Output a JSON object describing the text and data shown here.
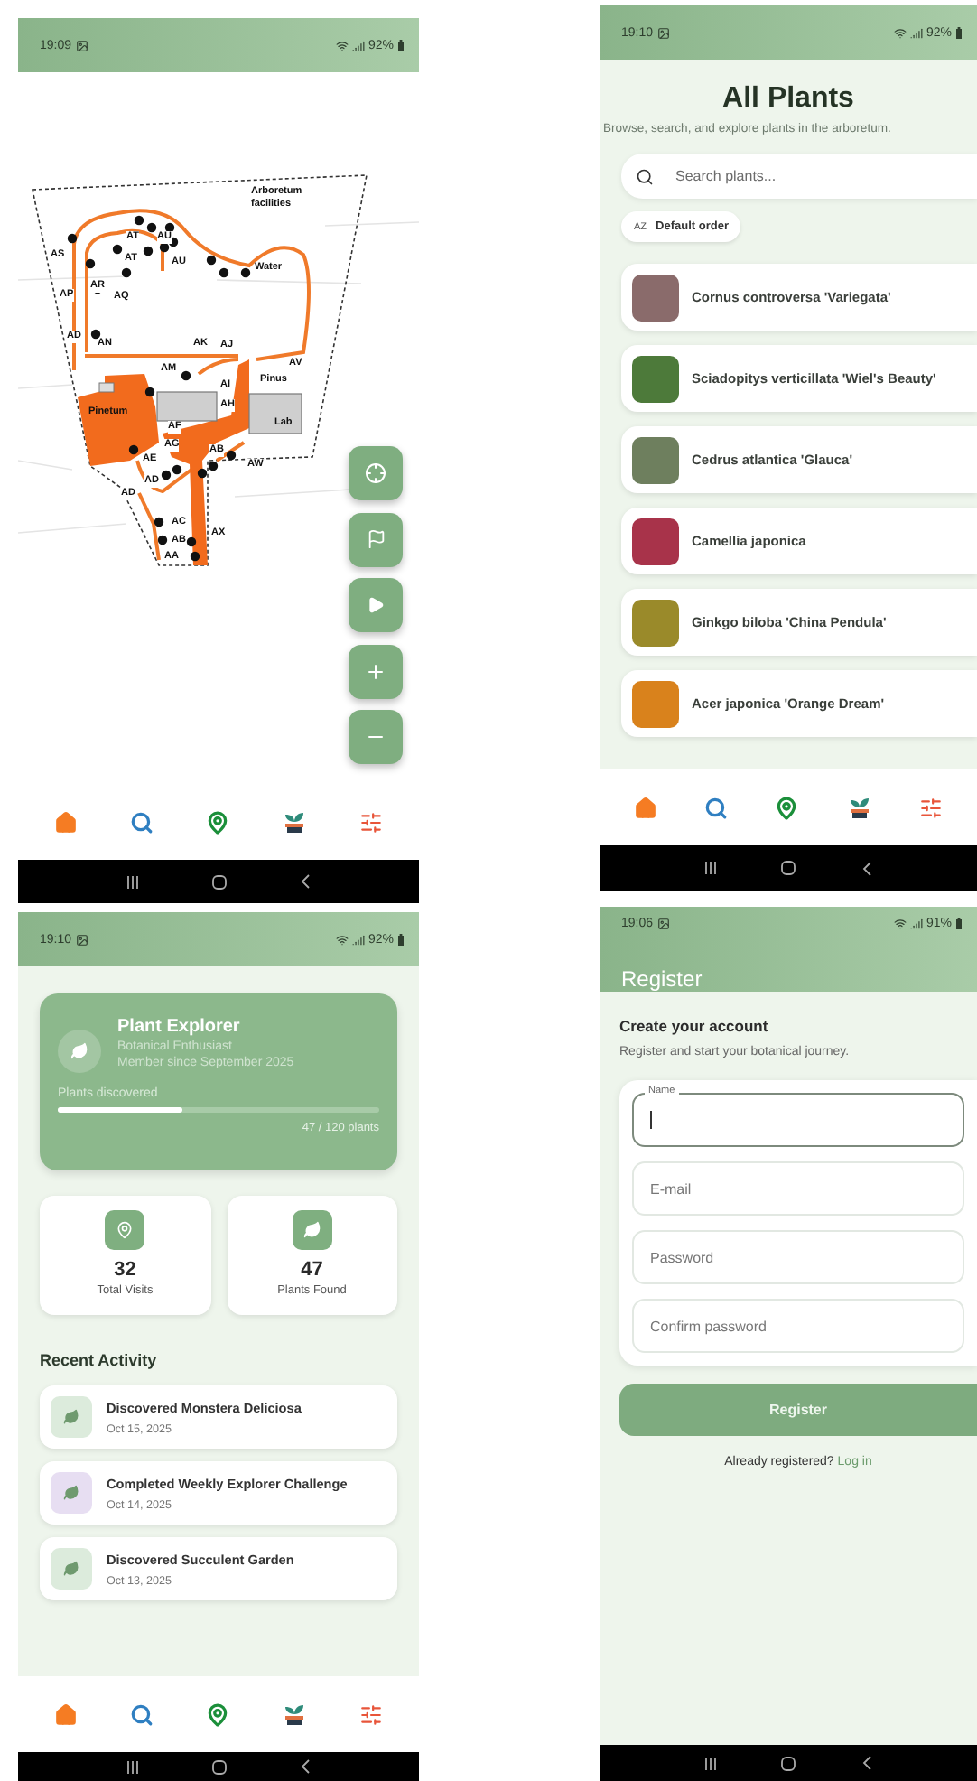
{
  "screens": [
    {
      "kind": "map",
      "status": {
        "time": "19:09",
        "battery": "92%"
      },
      "map_labels": [
        "Arboretum facilities",
        "AS",
        "AT",
        "AU",
        "AT",
        "AU",
        "Water",
        "AR",
        "AQ",
        "AP",
        "AD",
        "AN",
        "AK",
        "AJ",
        "AV",
        "AM",
        "Pinus",
        "AI",
        "AH",
        "Pinetum",
        "Lab",
        "AF",
        "AG",
        "AB",
        "AE",
        "AW",
        "AD",
        "AD",
        "AC",
        "AB",
        "AX",
        "AA"
      ]
    },
    {
      "kind": "plants",
      "status": {
        "time": "19:10",
        "battery": "92%"
      },
      "title": "All Plants",
      "subtitle": "Browse, search, and explore plants in the arboretum.",
      "search": {
        "placeholder": "Search plants..."
      },
      "sort": {
        "icon_text": "AZ",
        "label": "Default order"
      },
      "plants": [
        {
          "name": "Cornus controversa 'Variegata'"
        },
        {
          "name": "Sciadopitys verticillata 'Wiel's Beauty'"
        },
        {
          "name": "Cedrus atlantica 'Glauca'"
        },
        {
          "name": "Camellia japonica"
        },
        {
          "name": "Ginkgo biloba 'China Pendula'"
        },
        {
          "name": "Acer japonica 'Orange Dream'"
        }
      ]
    },
    {
      "kind": "profile",
      "status": {
        "time": "19:10",
        "battery": "92%"
      },
      "profile": {
        "name": "Plant Explorer",
        "role": "Botanical Enthusiast",
        "member_since": "Member since September 2025",
        "progress_label": "Plants discovered",
        "level": 0.39,
        "progress_text": "47 / 120 plants"
      },
      "stats": [
        {
          "value": "32",
          "label": "Total Visits"
        },
        {
          "value": "47",
          "label": "Plants Found"
        }
      ],
      "recent_title": "Recent Activity",
      "activities": [
        {
          "title": "Discovered Monstera Deliciosa",
          "date": "Oct 15, 2025",
          "color": "#dcebdc"
        },
        {
          "title": "Completed Weekly Explorer Challenge",
          "date": "Oct 14, 2025",
          "color": "#e7def2"
        },
        {
          "title": "Discovered Succulent Garden",
          "date": "Oct 13, 2025",
          "color": "#dcebdc"
        }
      ]
    },
    {
      "kind": "register",
      "status": {
        "time": "19:06",
        "battery": "91%"
      },
      "app_bar_title": "Register",
      "heading": "Create your account",
      "subheading": "Register and start your botanical journey.",
      "fields": [
        {
          "label": "Name",
          "focused": true
        },
        {
          "placeholder": "E-mail",
          "focused": false
        },
        {
          "placeholder": "Password",
          "focused": false
        },
        {
          "placeholder": "Confirm password",
          "focused": false
        }
      ],
      "submit": "Register",
      "login_prompt": "Already registered?",
      "login_link": "Log in"
    }
  ]
}
